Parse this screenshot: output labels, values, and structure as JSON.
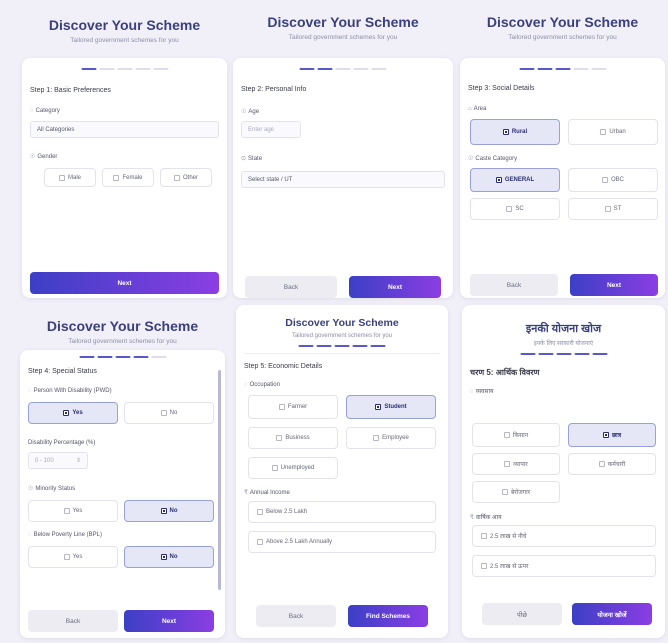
{
  "screens": [
    {
      "title": "Discover Your Scheme",
      "subtitle": "Tailored government schemes for you",
      "step_title": "Step 1: Basic Preferences",
      "category_label": "Category",
      "category_value": "All Categories",
      "gender_label": "Gender",
      "gender_options": [
        "Male",
        "Female",
        "Other"
      ],
      "next_label": "Next"
    },
    {
      "title": "Discover Your Scheme",
      "subtitle": "Tailored government schemes for you",
      "step_title": "Step 2: Personal Info",
      "age_label": "Age",
      "age_placeholder": "Enter age",
      "state_label": "State",
      "state_value": "Select state / UT",
      "back_label": "Back",
      "next_label": "Next"
    },
    {
      "title": "Discover Your Scheme",
      "subtitle": "Tailored government schemes for you",
      "step_title": "Step 3: Social Details",
      "area_label": "Area",
      "area_options": [
        "Rural",
        "Urban"
      ],
      "caste_label": "Caste Category",
      "caste_options": [
        "GENERAL",
        "OBC",
        "SC",
        "ST"
      ],
      "back_label": "Back",
      "next_label": "Next"
    },
    {
      "title": "Discover Your Scheme",
      "subtitle": "Tailored government schemes for you",
      "step_title": "Step 4: Special Status",
      "disability_label": "Person With Disability (PWD)",
      "disability_options": [
        "Yes",
        "No"
      ],
      "disability_pct_label": "Disability Percentage (%)",
      "disability_pct_value": "0 - 100",
      "minority_label": "Minority Status",
      "minority_options": [
        "Yes",
        "No"
      ],
      "bpl_label": "Below Poverty Line (BPL)",
      "bpl_options": [
        "Yes",
        "No"
      ],
      "back_label": "Back",
      "next_label": "Next"
    },
    {
      "title": "Discover Your Scheme",
      "subtitle": "Tailored government schemes for you",
      "step_title": "Step 5: Economic Details",
      "occupation_label": "Occupation",
      "occupation_options": [
        "Farmer",
        "Student",
        "Business",
        "Employee",
        "Unemployed"
      ],
      "income_label": "Annual Income",
      "income_options": [
        "Below 2.5 Lakh",
        "Above 2.5 Lakh Annually"
      ],
      "back_label": "Back",
      "find_label": "Find Schemes"
    },
    {
      "title": "इनकी योजना खोज",
      "subtitle": "इनके लिए सरकारी योजनाएं",
      "step_title": "चरण 5: आर्थिक विवरण",
      "occupation_label": "व्यवसाय",
      "occupation_options": [
        "किसान",
        "छात्र",
        "व्यापार",
        "कर्मचारी",
        "बेरोजगार"
      ],
      "income_label": "वार्षिक आय",
      "income_options": [
        "2.5 लाख से नीचे",
        "2.5 लाख से ऊपर"
      ],
      "back_label": "पीछे",
      "find_label": "योजना खोजें"
    }
  ],
  "colors": {
    "accent_start": "#3c3fc6",
    "accent_end": "#8b3ee3",
    "title": "#3b3f7d",
    "selected_bg": "#e6e7f6"
  }
}
